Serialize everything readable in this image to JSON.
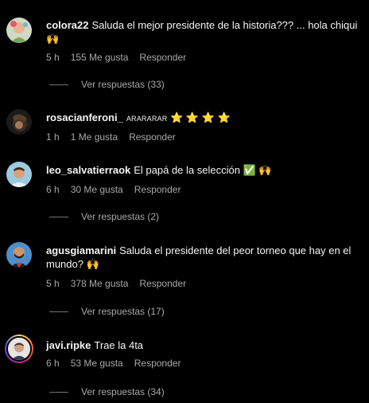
{
  "comments": [
    {
      "username": "colora22",
      "text": "Saluda el mejor presidente de la historia??? ... hola chiqui",
      "emoji": "🙌",
      "time": "5 h",
      "likes": "155 Me gusta",
      "reply": "Responder",
      "replies": "Ver respuestas (33)"
    },
    {
      "username": "rosacianferoni_",
      "text": "ARARARAR",
      "emoji": "⭐ ⭐ ⭐ ⭐",
      "time": "1 h",
      "likes": "1 Me gusta",
      "reply": "Responder"
    },
    {
      "username": "leo_salvatierraok",
      "text": "El papá de la selección",
      "emoji": "✅ 🙌",
      "time": "6 h",
      "likes": "30 Me gusta",
      "reply": "Responder",
      "replies": "Ver respuestas (2)"
    },
    {
      "username": "agusgiamarini",
      "text": "Saluda el presidente del peor torneo que hay en el mundo?",
      "emoji": "🙌",
      "time": "5 h",
      "likes": "378 Me gusta",
      "reply": "Responder",
      "replies": "Ver respuestas (17)"
    },
    {
      "username": "javi.ripke",
      "text": "Trae la 4ta",
      "time": "6 h",
      "likes": "53 Me gusta",
      "reply": "Responder",
      "replies": "Ver respuestas (34)"
    }
  ],
  "colors": {
    "background": "#000000",
    "text": "#f5f5f5",
    "secondary": "#a8a8a8",
    "story_ring": "#c13584"
  }
}
